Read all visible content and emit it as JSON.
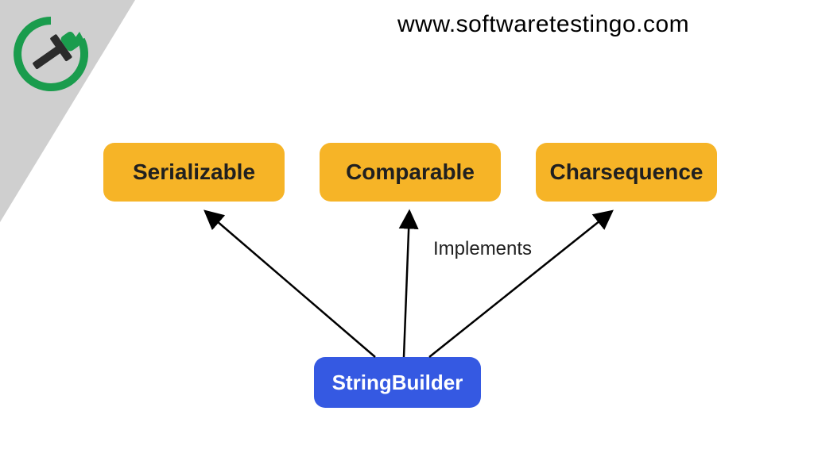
{
  "header": {
    "url": "www.softwaretestingo.com"
  },
  "diagram": {
    "interfaces": {
      "serializable": "Serializable",
      "comparable": "Comparable",
      "charsequence": "Charsequence"
    },
    "class_name": "StringBuilder",
    "relationship_label": "Implements"
  },
  "colors": {
    "interface_bg": "#f6b427",
    "class_bg": "#3559e2",
    "corner_bg": "#cfcfcf",
    "logo_green": "#1a9c4d",
    "logo_dark": "#2b2b2b"
  }
}
